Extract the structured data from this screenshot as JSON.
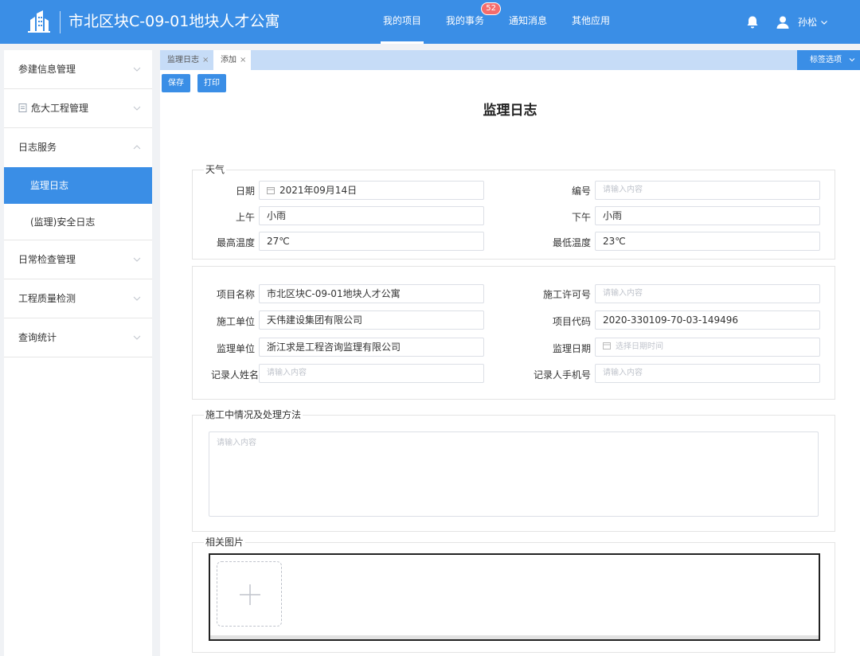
{
  "header": {
    "title": "市北区块C-09-01地块人才公寓",
    "nav": [
      {
        "label": "我的项目",
        "active": true
      },
      {
        "label": "我的事务",
        "badge": "52"
      },
      {
        "label": "通知消息"
      },
      {
        "label": "其他应用"
      }
    ],
    "user_name": "孙松",
    "accent": "#3a8ee6",
    "badge_color": "#f56c6c"
  },
  "sidebar": {
    "items": [
      {
        "label": "参建信息管理"
      },
      {
        "label": "危大工程管理"
      },
      {
        "label": "日志服务",
        "expanded": true
      },
      {
        "label": "监理日志",
        "active": true
      },
      {
        "label": "(监理)安全日志"
      },
      {
        "label": "日常检查管理"
      },
      {
        "label": "工程质量检测"
      },
      {
        "label": "查询统计"
      }
    ]
  },
  "tabs": {
    "items": [
      {
        "label": "监理日志",
        "close": "×"
      },
      {
        "label": "添加",
        "close": "×",
        "active": true
      }
    ],
    "options_label": "标签选项"
  },
  "toolbar": {
    "save_label": "保存",
    "print_label": "打印"
  },
  "page": {
    "title": "监理日志"
  },
  "weather": {
    "legend": "天气",
    "date_label": "日期",
    "date_value": "2021年09月14日",
    "number_label": "编号",
    "number_placeholder": "请输入内容",
    "am_label": "上午",
    "am_value": "小雨",
    "pm_label": "下午",
    "pm_value": "小雨",
    "max_temp_label": "最高温度",
    "max_temp_value": "27℃",
    "min_temp_label": "最低温度",
    "min_temp_value": "23℃"
  },
  "project": {
    "name_label": "项目名称",
    "name_value": "市北区块C-09-01地块人才公寓",
    "permit_label": "施工许可号",
    "permit_placeholder": "请输入内容",
    "contractor_label": "施工单位",
    "contractor_value": "天伟建设集团有限公司",
    "code_label": "项目代码",
    "code_value": "2020-330109-70-03-149496",
    "supervisor_label": "监理单位",
    "supervisor_value": "浙江求是工程咨询监理有限公司",
    "supervise_date_label": "监理日期",
    "supervise_date_placeholder": "选择日期时间",
    "recorder_label": "记录人姓名",
    "recorder_placeholder": "请输入内容",
    "phone_label": "记录人手机号",
    "phone_placeholder": "请输入内容"
  },
  "situation": {
    "legend": "施工中情况及处理方法",
    "placeholder": "请输入内容"
  },
  "images": {
    "legend": "相关图片"
  }
}
